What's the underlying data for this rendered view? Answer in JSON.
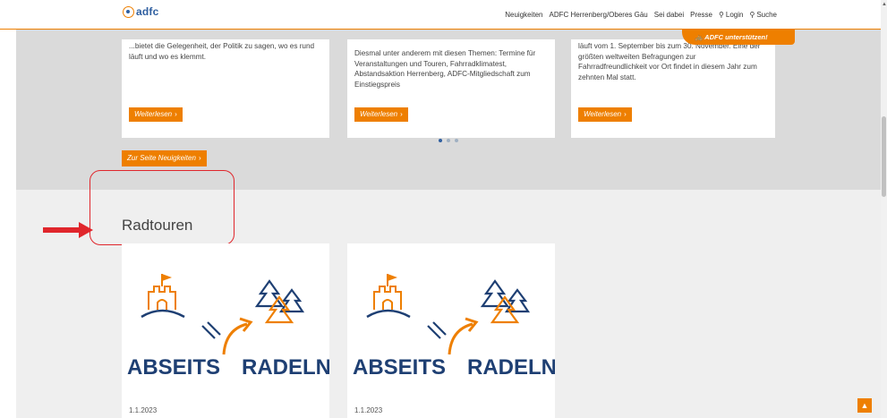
{
  "header": {
    "logo_text": "adfc",
    "nav": [
      {
        "label": "Neuigkeiten"
      },
      {
        "label": "ADFC Herrenberg/Oberes Gäu"
      },
      {
        "label": "Sei dabei"
      },
      {
        "label": "Presse"
      },
      {
        "label": "Login",
        "icon": "user-icon"
      },
      {
        "label": "Suche",
        "icon": "search-icon"
      }
    ],
    "support_label": "ADFC unterstützen!"
  },
  "news": {
    "cards": [
      {
        "text": "...bietet die Gelegenheit, der Politik zu sagen, wo es rund läuft und wo es klemmt.",
        "button": "Weiterlesen"
      },
      {
        "text": "Diesmal unter anderem mit diesen Themen: Termine für Veranstaltungen und Touren, Fahrradklimatest, Abstandsaktion Herrenberg, ADFC-Mitgliedschaft zum Einstiegspreis",
        "button": "Weiterlesen"
      },
      {
        "text": "läuft vom 1. September bis zum 30. November. Eine der größten weltweiten Befragungen zur Fahrradfreundlichkeit vor Ort findet in diesem Jahr zum zehnten Mal statt.",
        "button": "Weiterlesen"
      }
    ],
    "all_button": "Zur Seite Neuigkeiten"
  },
  "tours": {
    "title": "Radtouren",
    "cards": [
      {
        "image_word1": "ABSEITS",
        "image_word2": "RADELN",
        "date": "1.1.2023"
      },
      {
        "image_word1": "ABSEITS",
        "image_word2": "RADELN",
        "date": "1.1.2023"
      }
    ]
  },
  "colors": {
    "accent": "#ee7f00",
    "brand_blue": "#2f5fa0",
    "highlight": "#e0262c"
  }
}
